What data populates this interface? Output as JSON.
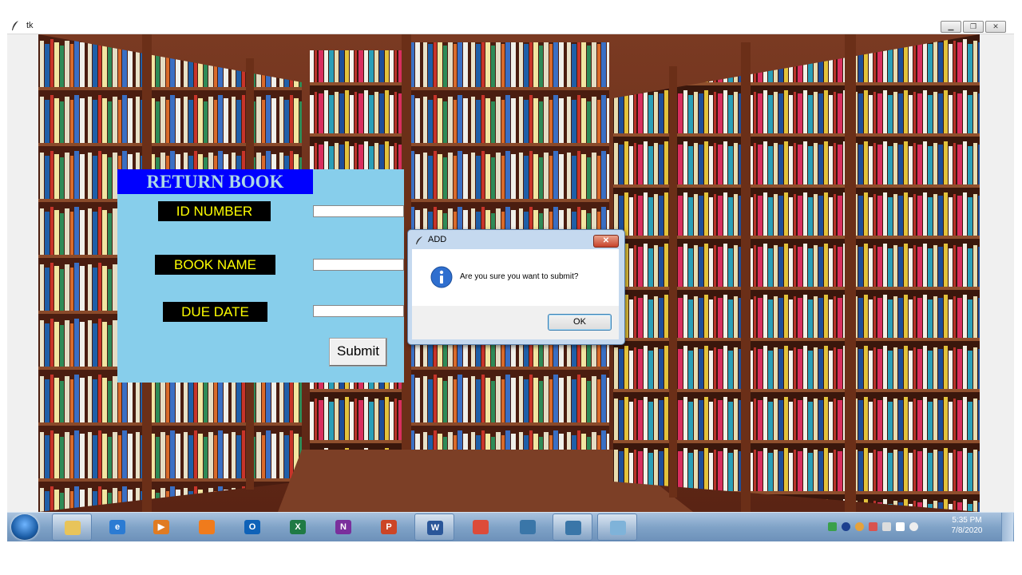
{
  "window": {
    "title": "tk",
    "minimize_icon": "minimize-icon",
    "restore_icon": "restore-icon",
    "close_icon": "close-icon"
  },
  "form": {
    "title": "RETURN BOOK",
    "id_number_label": "ID NUMBER",
    "id_number_value": "",
    "book_name_label": "BOOK NAME",
    "book_name_value": "",
    "due_date_label": "DUE DATE",
    "due_date_value": "",
    "submit_label": "Submit"
  },
  "dialog": {
    "title": "ADD",
    "message": "Are you sure you want to submit?",
    "ok_label": "OK",
    "icon": "info-icon",
    "close_icon": "close-icon"
  },
  "taskbar": {
    "start_icon": "windows-start-icon",
    "apps": [
      {
        "name": "file-explorer",
        "icon": "folder-icon",
        "color": "#e8c45a",
        "label": ""
      },
      {
        "name": "internet-explorer",
        "icon": "ie-icon",
        "color": "#2b7bd3",
        "label": "e"
      },
      {
        "name": "media-player",
        "icon": "media-icon",
        "color": "#e07b22",
        "label": "▶"
      },
      {
        "name": "firefox",
        "icon": "firefox-icon",
        "color": "#f07b1c",
        "label": ""
      },
      {
        "name": "outlook",
        "icon": "outlook-icon",
        "color": "#0f62b8",
        "label": "O"
      },
      {
        "name": "excel",
        "icon": "excel-icon",
        "color": "#1f7a44",
        "label": "X"
      },
      {
        "name": "onenote",
        "icon": "onenote-icon",
        "color": "#7a2f9c",
        "label": "N"
      },
      {
        "name": "powerpoint",
        "icon": "powerpoint-icon",
        "color": "#cc4526",
        "label": "P"
      },
      {
        "name": "word",
        "icon": "word-icon",
        "color": "#2a5699",
        "label": "W"
      },
      {
        "name": "chrome",
        "icon": "chrome-icon",
        "color": "#dd4b39",
        "label": ""
      },
      {
        "name": "python",
        "icon": "python-icon",
        "color": "#3a76a8",
        "label": ""
      },
      {
        "name": "python-idle",
        "icon": "python-icon",
        "color": "#3a76a8",
        "label": ""
      },
      {
        "name": "notepad",
        "icon": "notepad-icon",
        "color": "#7fb3d9",
        "label": ""
      }
    ],
    "time": "5:35 PM",
    "date": "7/8/2020"
  }
}
